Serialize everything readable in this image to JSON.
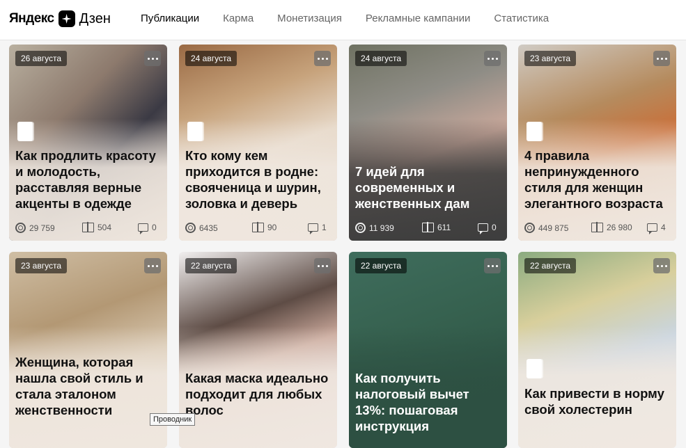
{
  "header": {
    "logo_left": "Яндекс",
    "logo_right": "Дзен",
    "nav": [
      {
        "label": "Публикации",
        "active": true
      },
      {
        "label": "Карма",
        "active": false
      },
      {
        "label": "Монетизация",
        "active": false
      },
      {
        "label": "Рекламные кампании",
        "active": false
      },
      {
        "label": "Статистика",
        "active": false
      }
    ]
  },
  "cards": [
    {
      "date": "26 августа",
      "title": "Как продлить красоту и молодость, расставляя верные акценты в одежде",
      "views": "29 759",
      "reads": "504",
      "comments": "0",
      "theme": "light",
      "bg": "linear-gradient(135deg,#b9b0a0 0%,#8d7a6d 35%,#3b3a44 60%,#c9b8a6 100%)"
    },
    {
      "date": "24 августа",
      "title": "Кто кому кем приходится в родне: свояченица и шурин, золовка и деверь",
      "views": "6435",
      "reads": "90",
      "comments": "1",
      "theme": "light",
      "bg": "linear-gradient(160deg,#9a6a44 0%,#c7a37c 30%,#e7d9c9 55%,#d7c3ae 100%)"
    },
    {
      "date": "24 августа",
      "title": "7 идей для современных и женственных дам",
      "views": "11 939",
      "reads": "611",
      "comments": "0",
      "theme": "dark",
      "bg": "linear-gradient(160deg,#6f7262 0%,#8f8d86 30%,#c9a89b 55%,#5c5b58 100%)"
    },
    {
      "date": "23 августа",
      "title": "4 правила непринужденного стиля для женщин элегантного возраста",
      "views": "449 875",
      "reads": "26 980",
      "comments": "4",
      "theme": "light",
      "bg": "linear-gradient(160deg,#d0cbc4 0%,#b58b5e 35%,#c9703a 55%,#ddd6cf 100%)"
    },
    {
      "date": "23 августа",
      "title": "Женщина, которая нашла свой стиль и стала эталоном женственности",
      "views": "",
      "reads": "",
      "comments": "",
      "theme": "light",
      "bg": "linear-gradient(160deg,#cfbea4 0%,#b39874 35%,#d7c6ae 60%,#e2d6c6 100%)"
    },
    {
      "date": "22 августа",
      "title": "Какая маска идеально подходит для любых волос",
      "views": "",
      "reads": "",
      "comments": "",
      "theme": "light",
      "bg": "linear-gradient(160deg,#f1efef 0%,#5e4c45 35%,#c9a79a 55%,#e6dce6 100%)"
    },
    {
      "date": "22 августа",
      "title": "Как получить налоговый вычет 13%: пошаговая инструкция",
      "views": "",
      "reads": "",
      "comments": "",
      "theme": "dark",
      "bg": "linear-gradient(160deg,#3f6d5d 0%,#36614f 40%,#2f5646 70%,#2a4d3f 100%)"
    },
    {
      "date": "22 августа",
      "title": "Как привести в норму свой холестерин",
      "views": "",
      "reads": "",
      "comments": "",
      "theme": "light",
      "bg": "linear-gradient(160deg,#8bab80 0%,#d8cf9c 30%,#c9d5e0 55%,#eef0f3 100%)"
    }
  ],
  "tooltip": "Проводник"
}
